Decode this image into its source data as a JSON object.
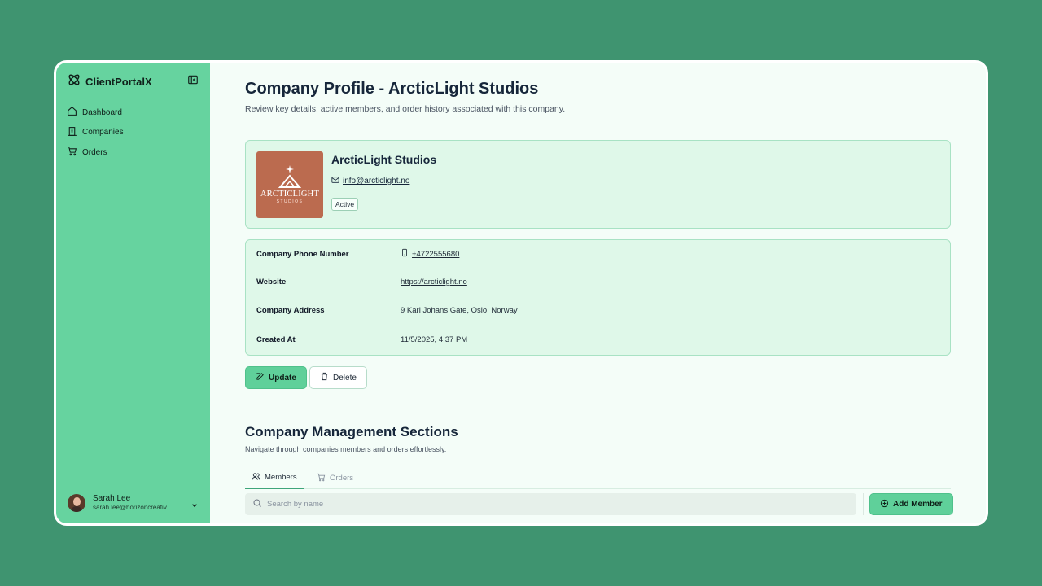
{
  "sidebar": {
    "brand": "ClientPortalX",
    "items": [
      {
        "label": "Dashboard",
        "icon": "home-icon"
      },
      {
        "label": "Companies",
        "icon": "building-icon"
      },
      {
        "label": "Orders",
        "icon": "cart-icon"
      }
    ],
    "user": {
      "name": "Sarah Lee",
      "email": "sarah.lee@horizoncreativ..."
    }
  },
  "main": {
    "title": "Company Profile - ArcticLight Studios",
    "subtitle": "Review key details, active members, and order history associated with this company.",
    "profile": {
      "name": "ArcticLight Studios",
      "email": "info@arcticlight.no",
      "status": "Active",
      "logo_text": "ARCTICLIGHT",
      "logo_subtext": "STUDIOS"
    },
    "details": [
      {
        "label": "Company Phone Number",
        "value": "+4722555680"
      },
      {
        "label": "Website",
        "value": "https://arcticlight.no"
      },
      {
        "label": "Company Address",
        "value": "9 Karl Johans Gate, Oslo, Norway"
      },
      {
        "label": "Created At",
        "value": "11/5/2025, 4:37 PM"
      }
    ],
    "actions": {
      "update": "Update",
      "delete": "Delete"
    },
    "management": {
      "title": "Company Management Sections",
      "subtitle": "Navigate through companies members and orders effortlessly.",
      "tabs": [
        {
          "label": "Members"
        },
        {
          "label": "Orders"
        }
      ],
      "search_placeholder": "Search by name",
      "add_button": "Add Member"
    }
  },
  "colors": {
    "background": "#3f9470",
    "sidebar": "#66d39f",
    "accent": "#5fd09a",
    "card": "#dff8e9"
  }
}
